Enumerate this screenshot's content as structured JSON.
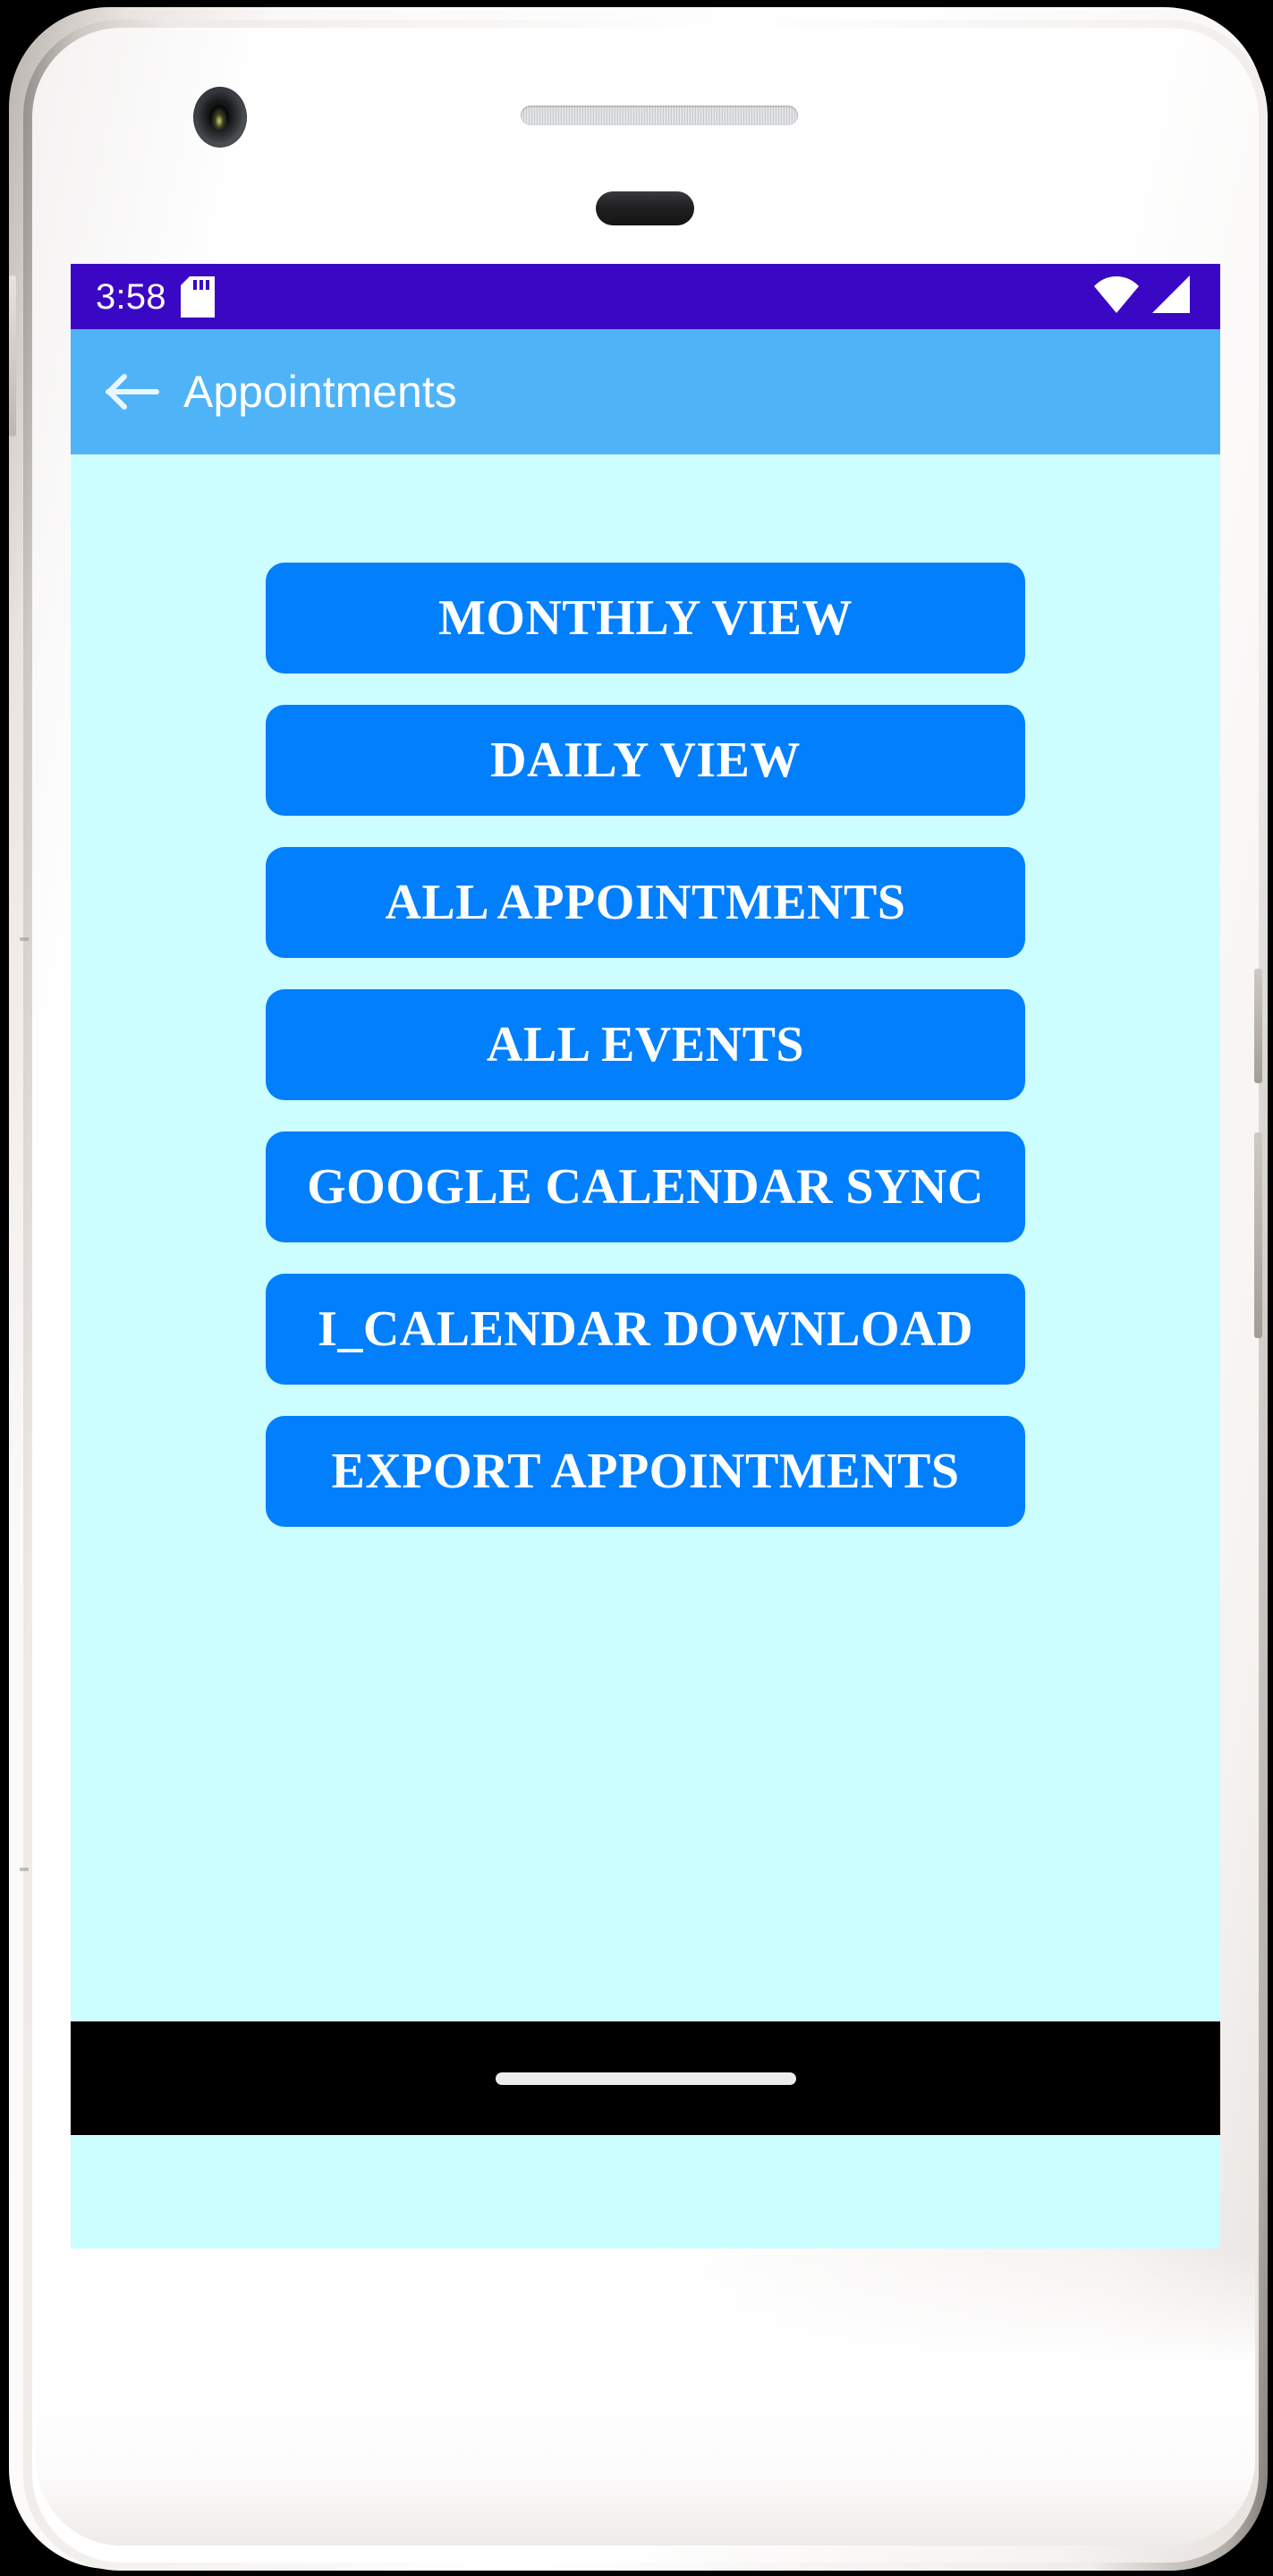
{
  "device": {
    "camera_icon": "front-camera-icon",
    "speaker_icon": "earpiece-speaker-icon",
    "sensor_icon": "proximity-sensor-icon"
  },
  "status_bar": {
    "time": "3:58",
    "background_color": "#3A07C4",
    "icons": [
      {
        "name": "sd-card-icon"
      },
      {
        "name": "wifi-icon"
      },
      {
        "name": "cellular-signal-icon"
      }
    ]
  },
  "app_bar": {
    "title": "Appointments",
    "back_icon": "back-arrow-icon",
    "background_color": "#4FB3F8"
  },
  "content": {
    "background_color": "#CCFDFF",
    "buttons": [
      {
        "label": "MONTHLY VIEW"
      },
      {
        "label": "DAILY VIEW"
      },
      {
        "label": "ALL APPOINTMENTS"
      },
      {
        "label": "ALL EVENTS"
      },
      {
        "label": "GOOGLE CALENDAR SYNC"
      },
      {
        "label": "I_CALENDAR DOWNLOAD"
      },
      {
        "label": "EXPORT APPOINTMENTS"
      }
    ],
    "button_color": "#027FFD"
  },
  "nav_bar": {
    "background_color": "#000000",
    "gesture_pill_color": "#ECECEC"
  }
}
